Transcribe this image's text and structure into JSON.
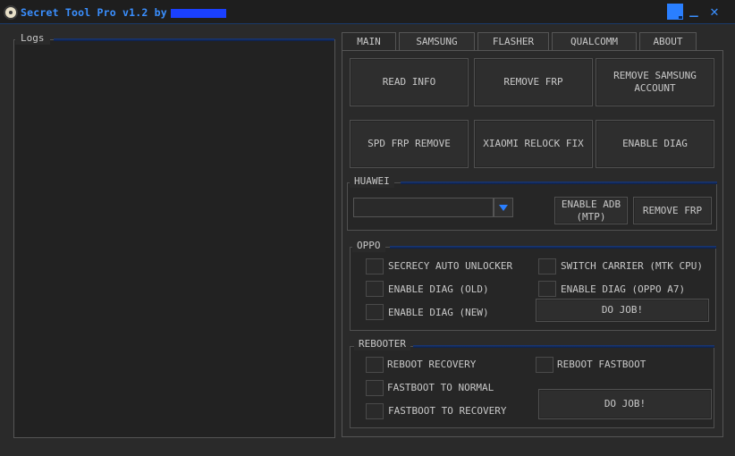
{
  "window": {
    "title": "Secret Tool Pro v1.2 by",
    "minimize_glyph": "_",
    "close_glyph": "✕"
  },
  "logs": {
    "label": "Logs"
  },
  "tabs": [
    {
      "label": "MAIN"
    },
    {
      "label": "SAMSUNG"
    },
    {
      "label": "FLASHER"
    },
    {
      "label": "QUALCOMM"
    },
    {
      "label": "ABOUT"
    }
  ],
  "main": {
    "buttons": {
      "read_info": "READ INFO",
      "remove_frp": "REMOVE FRP",
      "remove_samsung_account_l1": "REMOVE SAMSUNG",
      "remove_samsung_account_l2": "ACCOUNT",
      "spd_frp_remove": "SPD FRP REMOVE",
      "xiaomi_relock_fix": "XIAOMI RELOCK FIX",
      "enable_diag": "ENABLE DIAG"
    },
    "huawei": {
      "title": "HUAWEI",
      "combo_value": "",
      "enable_adb_l1": "ENABLE ADB",
      "enable_adb_l2": "(MTP)",
      "remove_frp": "REMOVE FRP"
    },
    "oppo": {
      "title": "OPPO",
      "options": [
        {
          "label": "SECRECY AUTO UNLOCKER",
          "checked": false
        },
        {
          "label": "SWITCH CARRIER (MTK CPU)",
          "checked": false
        },
        {
          "label": "ENABLE DIAG (OLD)",
          "checked": false
        },
        {
          "label": "ENABLE DIAG (OPPO A7)",
          "checked": false
        },
        {
          "label": "ENABLE DIAG (NEW)",
          "checked": false
        }
      ],
      "do_job": "DO JOB!"
    },
    "rebooter": {
      "title": "REBOOTER",
      "options": [
        {
          "label": "REBOOT RECOVERY",
          "checked": false
        },
        {
          "label": "REBOOT FASTBOOT",
          "checked": false
        },
        {
          "label": "FASTBOOT TO NORMAL",
          "checked": false
        },
        {
          "label": "FASTBOOT TO RECOVERY",
          "checked": false
        }
      ],
      "do_job": "DO JOB!"
    }
  },
  "colors": {
    "accent": "#2a7fff",
    "title_text": "#3a8fff",
    "background": "#2a2a2a"
  }
}
